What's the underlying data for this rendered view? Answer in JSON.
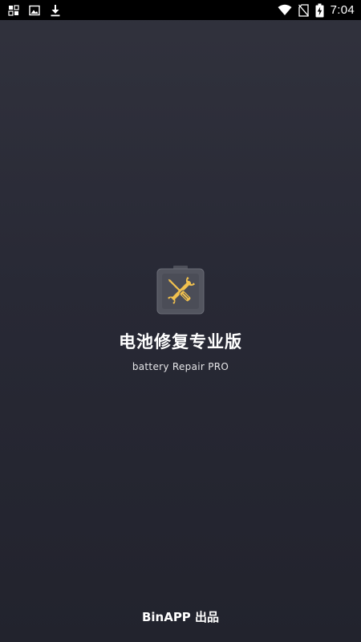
{
  "status_bar": {
    "time": "7:04",
    "left_icons": [
      "notification-grid-icon",
      "image-icon",
      "download-icon"
    ],
    "right_icons": [
      "wifi-icon",
      "no-sim-icon",
      "battery-charging-icon"
    ]
  },
  "splash": {
    "icon": "battery-repair-tools-icon",
    "title": "电池修复专业版",
    "subtitle": "battery Repair PRO"
  },
  "footer": {
    "credit": "BinAPP 出品"
  },
  "colors": {
    "background_top": "#31323d",
    "background_bottom": "#22232d",
    "icon_body": "#51535e",
    "icon_accent": "#f1c14e"
  }
}
